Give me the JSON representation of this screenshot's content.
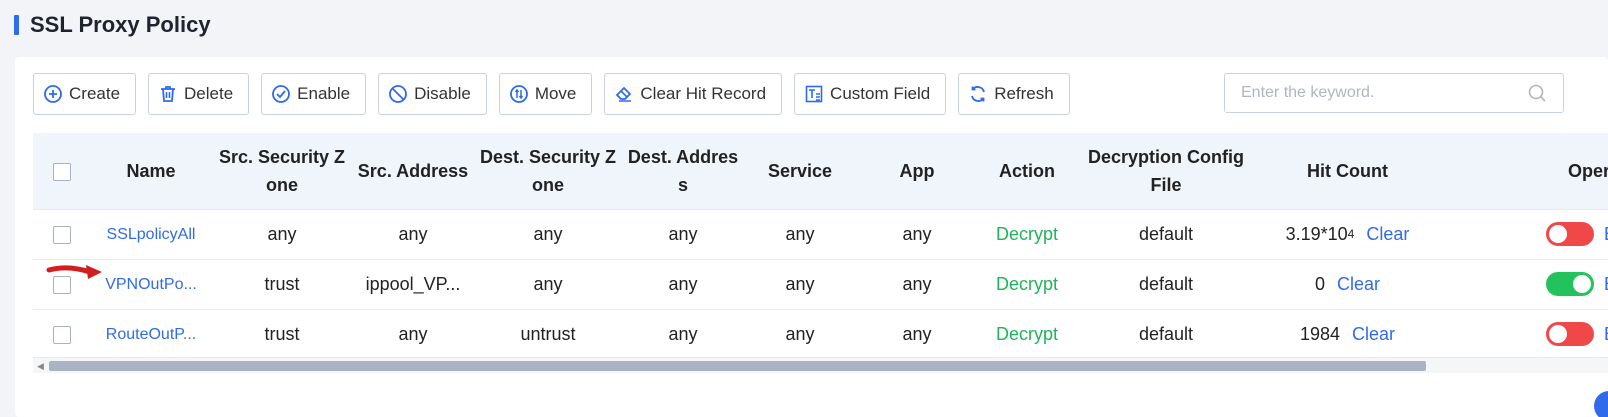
{
  "page": {
    "title": "SSL Proxy Policy"
  },
  "toolbar": {
    "create": "Create",
    "delete": "Delete",
    "enable": "Enable",
    "disable": "Disable",
    "move": "Move",
    "clear_hit": "Clear Hit Record",
    "custom_field": "Custom Field",
    "refresh": "Refresh"
  },
  "search": {
    "placeholder": "Enter the keyword."
  },
  "table": {
    "columns": {
      "name": "Name",
      "src_zone": "Src. Security Zone",
      "src_addr": "Src. Address",
      "dst_zone": "Dest. Security Zone",
      "dst_addr": "Dest. Address",
      "service": "Service",
      "app": "App",
      "action": "Action",
      "decrypt_cfg": "Decryption Config File",
      "hit_count": "Hit Count",
      "operation": "Oper"
    },
    "rows": [
      {
        "name": "SSLpolicyAll",
        "src_zone": "any",
        "src_addr": "any",
        "dst_zone": "any",
        "dst_addr": "any",
        "service": "any",
        "app": "any",
        "action": "Decrypt",
        "decrypt_cfg": "default",
        "hit_base": "3.19*10",
        "hit_exp": "4",
        "clear": "Clear",
        "enabled": false,
        "op": "E"
      },
      {
        "name": "VPNOutPo...",
        "src_zone": "trust",
        "src_addr": "ippool_VP...",
        "dst_zone": "any",
        "dst_addr": "any",
        "service": "any",
        "app": "any",
        "action": "Decrypt",
        "decrypt_cfg": "default",
        "hit_base": "0",
        "hit_exp": "",
        "clear": "Clear",
        "enabled": true,
        "op": "E"
      },
      {
        "name": "RouteOutP...",
        "src_zone": "trust",
        "src_addr": "any",
        "dst_zone": "untrust",
        "dst_addr": "any",
        "service": "any",
        "app": "any",
        "action": "Decrypt",
        "decrypt_cfg": "default",
        "hit_base": "1984",
        "hit_exp": "",
        "clear": "Clear",
        "enabled": false,
        "op": "E"
      }
    ]
  },
  "colors": {
    "accent": "#2f6bea",
    "decrypt": "#1fb45a",
    "toggle_on": "#22c25c",
    "toggle_off": "#f04848",
    "annotation": "#d21e1e"
  }
}
